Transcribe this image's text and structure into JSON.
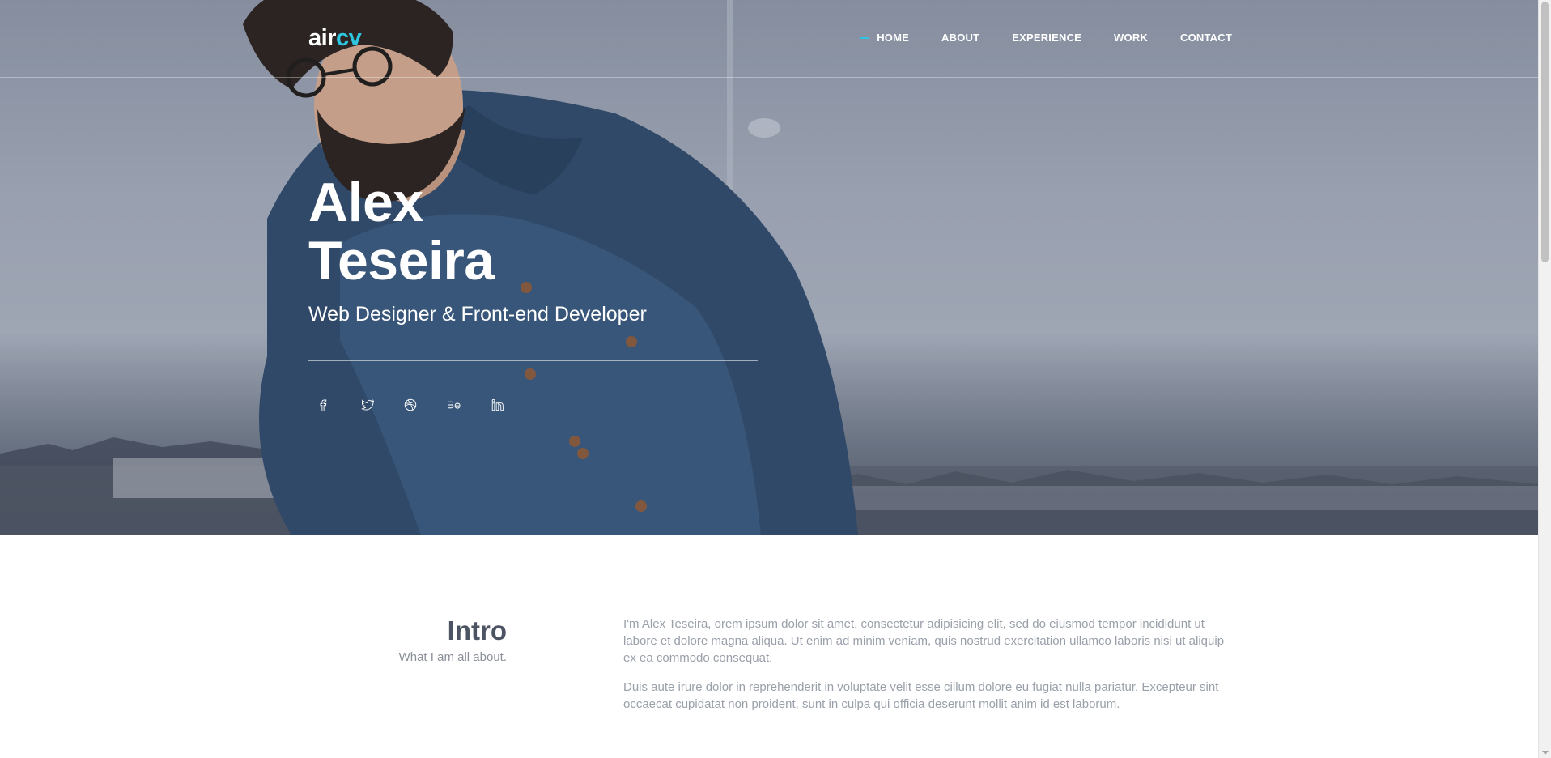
{
  "brand": {
    "part1": "air",
    "part2": "cv"
  },
  "nav": {
    "items": [
      {
        "label": "HOME",
        "active": true
      },
      {
        "label": "ABOUT",
        "active": false
      },
      {
        "label": "EXPERIENCE",
        "active": false
      },
      {
        "label": "WORK",
        "active": false
      },
      {
        "label": "CONTACT",
        "active": false
      }
    ]
  },
  "hero": {
    "first_name": "Alex",
    "last_name": "Teseira",
    "subtitle": "Web Designer & Front-end Developer"
  },
  "socials": [
    {
      "icon": "facebook-icon"
    },
    {
      "icon": "twitter-icon"
    },
    {
      "icon": "dribbble-icon"
    },
    {
      "icon": "behance-icon"
    },
    {
      "icon": "linkedin-icon"
    }
  ],
  "intro": {
    "title": "Intro",
    "subtitle": "What I am all about.",
    "paragraphs": [
      "I'm Alex Teseira, orem ipsum dolor sit amet, consectetur adipisicing elit, sed do eiusmod tempor incididunt ut labore et dolore magna aliqua. Ut enim ad minim veniam, quis nostrud exercitation ullamco laboris nisi ut aliquip ex ea commodo consequat.",
      "Duis aute irure dolor in reprehenderit in voluptate velit esse cillum dolore eu fugiat nulla pariatur. Excepteur sint occaecat cupidatat non proident, sunt in culpa qui officia deserunt mollit anim id est laborum."
    ]
  },
  "colors": {
    "accent": "#2ec5e0",
    "heading": "#4c5463",
    "body_text": "#9aa0aa"
  }
}
